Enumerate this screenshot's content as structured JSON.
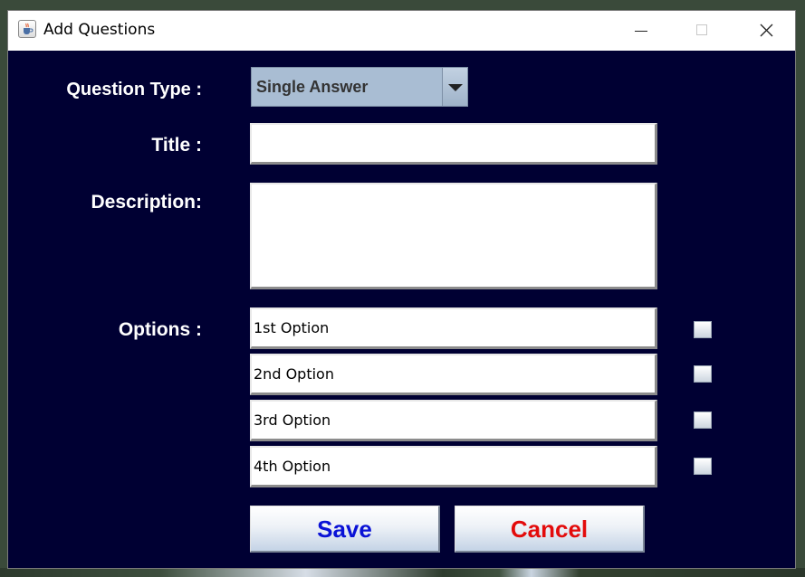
{
  "window": {
    "title": "Add Questions"
  },
  "form": {
    "question_type_label": "Question Type :",
    "question_type_value": "Single Answer",
    "title_label": "Title :",
    "title_value": "",
    "description_label": "Description:",
    "description_value": "",
    "options_label": "Options :",
    "options": [
      {
        "value": "1st Option",
        "correct": false
      },
      {
        "value": "2nd Option",
        "correct": false
      },
      {
        "value": "3rd Option",
        "correct": false
      },
      {
        "value": "4th Option",
        "correct": false
      }
    ]
  },
  "buttons": {
    "save_label": "Save",
    "cancel_label": "Cancel"
  },
  "colors": {
    "panel_background": "#000033",
    "save_text": "#0a12d6",
    "cancel_text": "#e30b0b",
    "combo_background": "#a9bdd3"
  },
  "icons": {
    "app_icon": "java-cup-icon",
    "minimize": "minimize-icon",
    "maximize": "maximize-icon",
    "close": "close-icon",
    "dropdown": "chevron-down-icon"
  }
}
